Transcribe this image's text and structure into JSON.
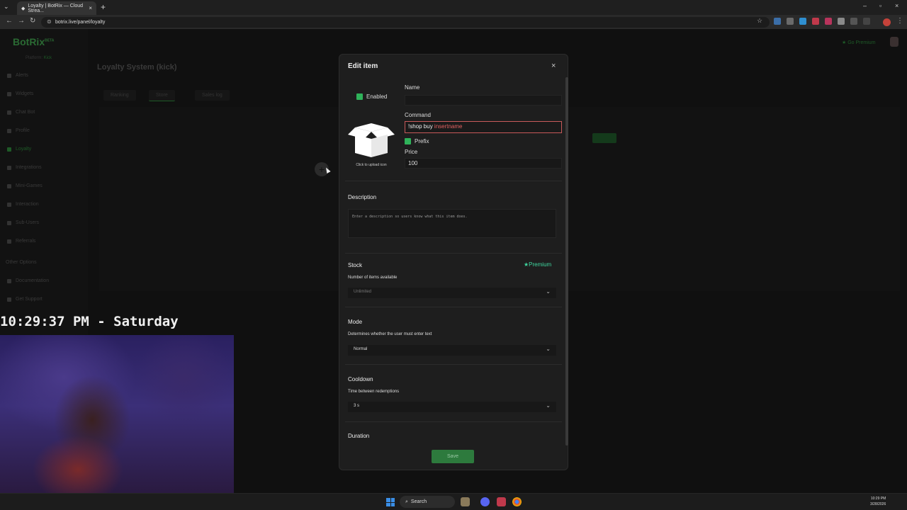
{
  "browser": {
    "tab_title": "Loyalty | BotRix — Cloud Strea...",
    "url": "botrix.live/panel/loyalty"
  },
  "app": {
    "logo": "BotRix",
    "beta": "BETA",
    "platform_label": "Platform:",
    "platform_value": "Kick",
    "sidebar": {
      "items": [
        "Alerts",
        "Widgets",
        "Chat Bot",
        "Profile",
        "Loyalty",
        "Integrations",
        "Mini-Games",
        "Interaction",
        "Sub-Users",
        "Referrals"
      ],
      "active": "Loyalty",
      "other_header": "Other Options",
      "other_items": [
        "Documentation",
        "Get Support"
      ]
    },
    "page_title": "Loyalty System (kick)",
    "tabs": [
      "Ranking",
      "Store",
      "Sales log"
    ],
    "go_premium": "Go Premium"
  },
  "overlay": {
    "clock": "10:29:37 PM - Saturday"
  },
  "modal": {
    "title": "Edit item",
    "close": "×",
    "enabled_label": "Enabled",
    "upload_label": "Click to upload icon",
    "name_label": "Name",
    "name_value": "",
    "command_label": "Command",
    "command_plain": "!shop buy ",
    "command_highlight": "insertname",
    "prefix_label": "Prefix",
    "price_label": "Price",
    "price_value": "100",
    "description_label": "Description",
    "description_placeholder": "Enter a description so users know what this item does.",
    "stock_label": "Stock",
    "premium_badge": "Premium",
    "stock_desc": "Number of items available",
    "stock_value": "Unlimited",
    "mode_label": "Mode",
    "mode_desc": "Determines whether the user must enter text",
    "mode_value": "Normal",
    "cooldown_label": "Cooldown",
    "cooldown_desc": "Time between redemptions",
    "cooldown_value": "3 s",
    "duration_label": "Duration",
    "save_label": "Save"
  },
  "taskbar": {
    "search_label": "Search",
    "time": "10:29 PM",
    "date": "3/28/2026"
  },
  "colors": {
    "accent_green": "#2fb35a",
    "command_border": "#c85a5a",
    "premium": "#3fd8a0"
  }
}
